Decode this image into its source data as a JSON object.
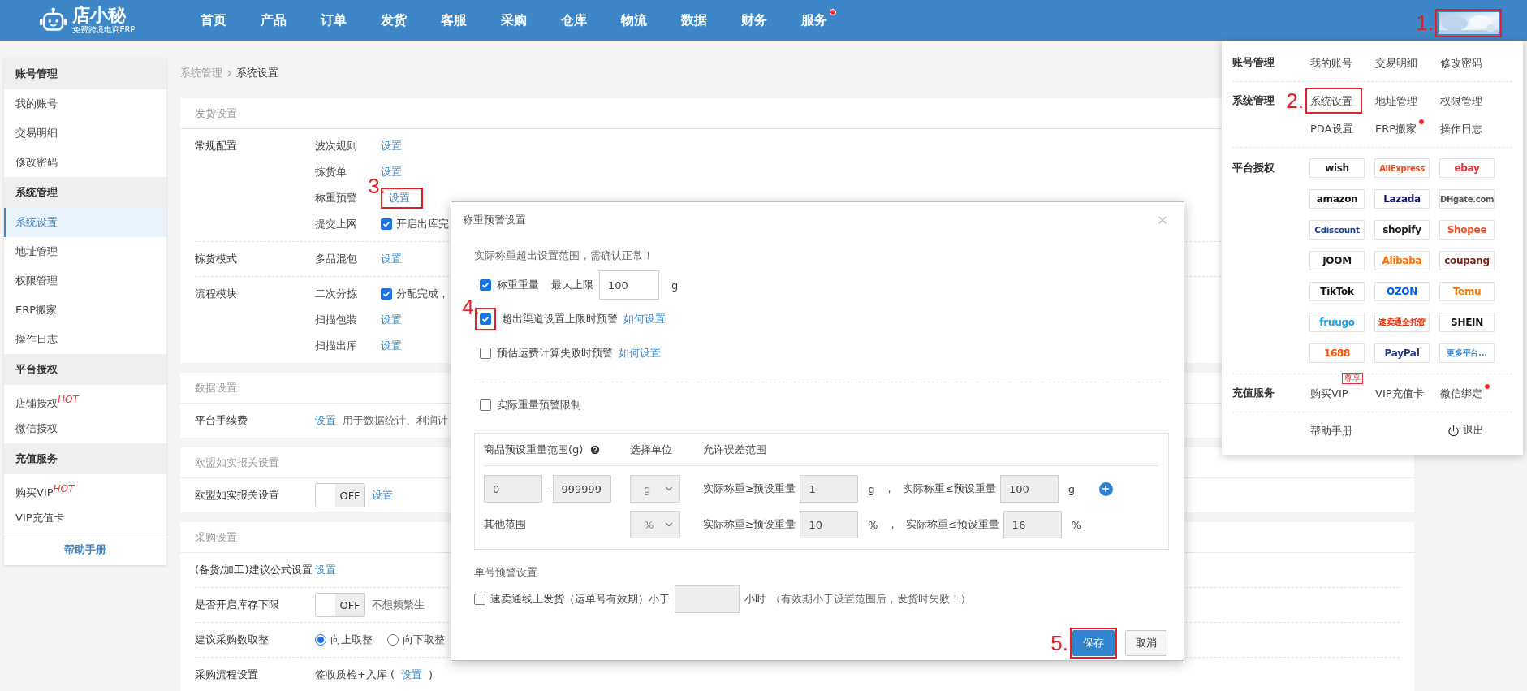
{
  "header": {
    "logo": {
      "name": "店小秘",
      "tagline": "免费跨境电商ERP"
    },
    "nav": [
      {
        "label": "首页",
        "dot": false
      },
      {
        "label": "产品",
        "dot": false
      },
      {
        "label": "订单",
        "dot": false
      },
      {
        "label": "发货",
        "dot": false
      },
      {
        "label": "客服",
        "dot": false
      },
      {
        "label": "采购",
        "dot": false
      },
      {
        "label": "仓库",
        "dot": false
      },
      {
        "label": "物流",
        "dot": false
      },
      {
        "label": "数据",
        "dot": false
      },
      {
        "label": "财务",
        "dot": false
      },
      {
        "label": "服务",
        "dot": true
      }
    ],
    "avatar": {
      "kind": "picture",
      "annotation": "1."
    }
  },
  "sidebar": {
    "groups": [
      {
        "title": "账号管理",
        "items": [
          {
            "label": "我的账号",
            "selected": false
          },
          {
            "label": "交易明细",
            "selected": false
          },
          {
            "label": "修改密码",
            "selected": false
          }
        ]
      },
      {
        "title": "系统管理",
        "items": [
          {
            "label": "系统设置",
            "selected": true
          },
          {
            "label": "地址管理",
            "selected": false
          },
          {
            "label": "权限管理",
            "selected": false
          },
          {
            "label": "ERP搬家",
            "selected": false
          },
          {
            "label": "操作日志",
            "selected": false
          }
        ]
      },
      {
        "title": "平台授权",
        "items": [
          {
            "label": "店铺授权",
            "sup": "HOT",
            "selected": false
          },
          {
            "label": "微信授权",
            "selected": false
          }
        ]
      },
      {
        "title": "充值服务",
        "items": [
          {
            "label": "购买VIP",
            "sup": "HOT",
            "selected": false
          },
          {
            "label": "VIP充值卡",
            "selected": false
          }
        ]
      }
    ],
    "help": "帮助手册"
  },
  "breadcrumb": [
    "系统管理",
    "系统设置"
  ],
  "sections": [
    {
      "title": "发货设置",
      "rows": [
        {
          "label": "常规配置",
          "entries": [
            {
              "sublabel": "波次规则",
              "parts": [
                {
                  "kind": "link",
                  "text": "设置"
                }
              ]
            },
            {
              "sublabel": "拣货单",
              "parts": [
                {
                  "kind": "link",
                  "text": "设置"
                }
              ]
            },
            {
              "sublabel": "称重预警",
              "parts": [
                {
                  "kind": "link",
                  "text": "设置",
                  "annotation": "3."
                }
              ]
            },
            {
              "sublabel": "提交上网",
              "parts": [
                {
                  "kind": "check",
                  "checked": true,
                  "text": "开启出库完"
                }
              ]
            }
          ]
        },
        {
          "label": "拣货模式",
          "entries": [
            {
              "sublabel": "多品混包",
              "parts": [
                {
                  "kind": "link",
                  "text": "设置"
                }
              ]
            }
          ]
        },
        {
          "label": "流程模块",
          "entries": [
            {
              "sublabel": "二次分拣",
              "parts": [
                {
                  "kind": "check",
                  "checked": true,
                  "text": "分配完成，"
                }
              ]
            },
            {
              "sublabel": "扫描包装",
              "parts": [
                {
                  "kind": "link",
                  "text": "设置"
                }
              ]
            },
            {
              "sublabel": "扫描出库",
              "parts": [
                {
                  "kind": "link",
                  "text": "设置"
                }
              ]
            }
          ]
        }
      ]
    },
    {
      "title": "数据设置",
      "rows": [
        {
          "label": "平台手续费",
          "entries": [
            {
              "parts": [
                {
                  "kind": "link",
                  "text": "设置"
                },
                {
                  "kind": "note",
                  "text": "用于数据统计、利润计"
                }
              ]
            }
          ]
        }
      ]
    },
    {
      "title": "欧盟如实报关设置",
      "rows": [
        {
          "label": "欧盟如实报关设置",
          "entries": [
            {
              "parts": [
                {
                  "kind": "toggle",
                  "on": false,
                  "text": "OFF"
                },
                {
                  "kind": "link",
                  "text": "设置"
                }
              ]
            }
          ]
        }
      ]
    },
    {
      "title": "采购设置",
      "rows": [
        {
          "label": "(备货/加工)建议公式设置",
          "entries": [
            {
              "parts": [
                {
                  "kind": "link",
                  "text": "设置"
                }
              ]
            }
          ]
        },
        {
          "label": "是否开启库存下限",
          "entries": [
            {
              "parts": [
                {
                  "kind": "toggle",
                  "on": false,
                  "text": "OFF"
                },
                {
                  "kind": "note",
                  "text": "不想频繁生"
                }
              ]
            }
          ]
        },
        {
          "label": "建议采购数取整",
          "entries": [
            {
              "parts": [
                {
                  "kind": "radio",
                  "selected": true,
                  "text": "向上取整"
                },
                {
                  "kind": "radio",
                  "selected": false,
                  "text": "向下取整"
                }
              ]
            }
          ]
        },
        {
          "label": "采购流程设置",
          "entries": [
            {
              "parts": [
                {
                  "kind": "text",
                  "text": "签收质检+入库 ("
                },
                {
                  "kind": "link",
                  "text": "设置"
                },
                {
                  "kind": "text",
                  "text": ")"
                }
              ]
            }
          ]
        }
      ]
    }
  ],
  "account_menu": {
    "groups": [
      {
        "title": "账号管理",
        "items": [
          {
            "label": "我的账号",
            "dot": false
          },
          {
            "label": "交易明细",
            "dot": false
          },
          {
            "label": "修改密码",
            "dot": false
          }
        ]
      },
      {
        "title": "系统管理",
        "items": [
          {
            "label": "系统设置",
            "dot": false,
            "annotation": "2."
          },
          {
            "label": "地址管理",
            "dot": false
          },
          {
            "label": "权限管理",
            "dot": false
          },
          {
            "label": "PDA设置",
            "dot": false
          },
          {
            "label": "ERP搬家",
            "dot": true
          },
          {
            "label": "操作日志",
            "dot": false
          }
        ]
      },
      {
        "title": "平台授权",
        "platforms": [
          {
            "label": "wish",
            "color": "#2b2b2b"
          },
          {
            "label": "AliExpress",
            "color": "#e8491d"
          },
          {
            "label": "ebay",
            "color": "#e53238"
          },
          {
            "label": "amazon",
            "color": "#111111"
          },
          {
            "label": "Lazada",
            "color": "#0f146d"
          },
          {
            "label": "DHgate.com",
            "color": "#555555"
          },
          {
            "label": "Cdiscount",
            "color": "#1c3f94"
          },
          {
            "label": "shopify",
            "color": "#222222"
          },
          {
            "label": "Shopee",
            "color": "#ee4d2d"
          },
          {
            "label": "JOOM",
            "color": "#1c1c1c"
          },
          {
            "label": "Alibaba",
            "color": "#ff6a00"
          },
          {
            "label": "coupang",
            "color": "#7a2a1d"
          },
          {
            "label": "TikTok",
            "color": "#111111"
          },
          {
            "label": "OZON",
            "color": "#005bff"
          },
          {
            "label": "Temu",
            "color": "#fb7701"
          },
          {
            "label": "fruugo",
            "color": "#1aa3e8"
          },
          {
            "label": "速卖通全托管",
            "color": "#e62e04"
          },
          {
            "label": "SHEIN",
            "color": "#111111"
          },
          {
            "label": "1688",
            "color": "#ff5000"
          },
          {
            "label": "PayPal",
            "color": "#253b80"
          },
          {
            "label": "更多平台...",
            "color": "#3d88c9"
          }
        ]
      },
      {
        "title": "充值服务",
        "items": [
          {
            "label": "购买VIP",
            "dot": false,
            "badge": "尊享"
          },
          {
            "label": "VIP充值卡",
            "dot": false
          },
          {
            "label": "微信绑定",
            "dot": true
          }
        ]
      }
    ],
    "footer": [
      {
        "label": "帮助手册",
        "kind": "help"
      },
      {
        "label": "退出",
        "kind": "logout"
      }
    ]
  },
  "dialog": {
    "title": "称重预警设置",
    "intro": "实际称重超出设置范围，需确认正常！",
    "options": [
      {
        "kind": "limit",
        "checked": true,
        "label": "称重重量",
        "field_label": "最大上限",
        "value": "100",
        "unit": "g"
      },
      {
        "kind": "check",
        "checked": true,
        "label": "超出渠道设置上限时预警",
        "link": "如何设置",
        "annotation": "4."
      },
      {
        "kind": "check",
        "checked": false,
        "label": "预估运费计算失败时预警",
        "link": "如何设置"
      }
    ],
    "weight_limit": {
      "checked": false,
      "label": "实际重量预警限制"
    },
    "range_table": {
      "columns": [
        "商品预设重量范围(g)",
        "选择单位",
        "允许误差范围"
      ],
      "rows": [
        {
          "kind": "range",
          "from": "0",
          "separator": "-",
          "to": "999999",
          "unit": "g",
          "lower_label": "实际称重≥预设重量",
          "lower": "1",
          "lower_unit": "g",
          "comma": "，",
          "upper_label": "实际称重≤预设重量",
          "upper": "100",
          "upper_unit": "g",
          "add": true
        },
        {
          "kind": "other",
          "label": "其他范围",
          "unit": "%",
          "lower_label": "实际称重≥预设重量",
          "lower": "10",
          "lower_unit": "%",
          "comma": "，",
          "upper_label": "实际称重≤预设重量",
          "upper": "16",
          "upper_unit": "%",
          "add": false
        }
      ]
    },
    "single": {
      "title": "单号预警设置",
      "checked": false,
      "label": "速卖通线上发货（运单号有效期）小于",
      "unit": "小时",
      "note": "（有效期小于设置范围后，发货时失败！）"
    },
    "buttons": [
      {
        "label": "保存",
        "kind": "primary",
        "annotation": "5."
      },
      {
        "label": "取消",
        "kind": "default"
      }
    ]
  }
}
